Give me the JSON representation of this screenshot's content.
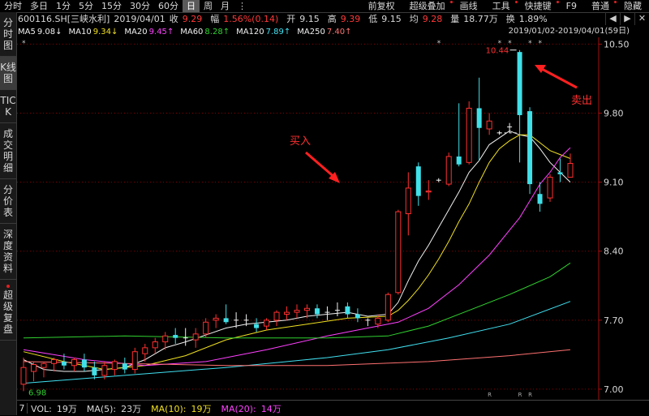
{
  "toolbar": {
    "items": [
      {
        "label": "分时",
        "selected": false
      },
      {
        "label": "多日",
        "selected": false
      },
      {
        "label": "1分",
        "selected": false
      },
      {
        "label": "5分",
        "selected": false
      },
      {
        "label": "15分",
        "selected": false
      },
      {
        "label": "30分",
        "selected": false
      },
      {
        "label": "60分",
        "selected": false
      },
      {
        "label": "日",
        "selected": true
      },
      {
        "label": "周",
        "selected": false
      },
      {
        "label": "月",
        "selected": false
      }
    ],
    "more_icon": "dots-vertical-icon",
    "right_items": [
      {
        "label": "前复权",
        "dot": false
      },
      {
        "label": "超级叠加",
        "dot": true
      },
      {
        "label": "画线",
        "dot": false
      },
      {
        "label": "工具",
        "dot": true
      },
      {
        "label": "快捷键",
        "dot": true
      },
      {
        "label": "F9",
        "dot": false
      },
      {
        "label": "普通",
        "dot": true
      },
      {
        "label": "隐藏",
        "dot": false
      }
    ]
  },
  "quote": {
    "code": "600116.SH[三峡水利]",
    "date": "2019/04/01",
    "close_label": "收",
    "close": "9.29",
    "change_label": "幅",
    "change": "1.56%(0.14)",
    "open_label": "开",
    "open": "9.15",
    "high_label": "高",
    "high": "9.39",
    "low_label": "低",
    "low": "9.15",
    "avg_label": "均",
    "avg": "9.28",
    "vol_label": "量",
    "vol": "18.77万",
    "turn_label": "换",
    "turn": "1.89%"
  },
  "window_buttons": {
    "prev": "◀",
    "next": "▶",
    "close": "✕"
  },
  "ma_line": [
    {
      "label": "MA5",
      "value": "9.08↓",
      "color": "#f0f0f0",
      "value_color": "#f0f0f0"
    },
    {
      "label": "MA10",
      "value": "9.34↓",
      "color": "#f0f0f0",
      "value_color": "#f0e020"
    },
    {
      "label": "MA20",
      "value": "9.45↑",
      "color": "#f0f0f0",
      "value_color": "#ff40ff"
    },
    {
      "label": "MA60",
      "value": "8.28↑",
      "color": "#f0f0f0",
      "value_color": "#30d030"
    },
    {
      "label": "MA120",
      "value": "7.89↑",
      "color": "#f0f0f0",
      "value_color": "#40e0f0"
    },
    {
      "label": "MA250",
      "value": "7.40↑",
      "color": "#f0f0f0",
      "value_color": "#ff7070"
    }
  ],
  "date_range": "2019/01/02-2019/04/01(59日)",
  "left_tabs": [
    {
      "label": "分时图",
      "selected": false,
      "dot": false
    },
    {
      "label": "K线图",
      "selected": true,
      "dot": false
    },
    {
      "label": "TICK",
      "selected": false,
      "dot": false
    },
    {
      "label": "成交明细",
      "selected": false,
      "dot": false
    },
    {
      "label": "分价表",
      "selected": false,
      "dot": false
    },
    {
      "label": "深度资料",
      "selected": false,
      "dot": false
    },
    {
      "label": "超级复盘",
      "selected": false,
      "dot": true
    }
  ],
  "annotations": {
    "buy": "买入",
    "sell": "卖出",
    "max_label": "10.44",
    "min_label": "6.98"
  },
  "bottom_bar": {
    "panel_num": "7",
    "vol_label": "VOL:",
    "vol": "19万",
    "ma5_label": "MA(5):",
    "ma5": "23万",
    "ma10_label": "MA(10):",
    "ma10": "19万",
    "ma20_label": "MA(20):",
    "ma20": "14万"
  },
  "colors": {
    "up": "#ff3030",
    "down": "#40e0e8",
    "flat": "#f0f0f0",
    "ma5": "#f0f0f0",
    "ma10": "#f0e020",
    "ma20": "#ff40ff",
    "ma60": "#30d030",
    "ma120": "#40e0f0",
    "ma250": "#ff7070",
    "grid": "#8b0000",
    "axis_text": "#d8d8d8"
  },
  "chart_data": {
    "type": "candlestick",
    "y_ticks": [
      7.0,
      7.7,
      8.4,
      9.1,
      9.8,
      10.5
    ],
    "ylim": [
      6.95,
      10.52
    ],
    "candles": [
      {
        "o": 7.05,
        "h": 7.32,
        "l": 6.98,
        "c": 7.22
      },
      {
        "o": 7.18,
        "h": 7.28,
        "l": 7.08,
        "c": 7.25
      },
      {
        "o": 7.22,
        "h": 7.28,
        "l": 7.12,
        "c": 7.26
      },
      {
        "o": 7.26,
        "h": 7.32,
        "l": 7.18,
        "c": 7.3
      },
      {
        "o": 7.28,
        "h": 7.36,
        "l": 7.2,
        "c": 7.24
      },
      {
        "o": 7.24,
        "h": 7.32,
        "l": 7.18,
        "c": 7.3
      },
      {
        "o": 7.3,
        "h": 7.36,
        "l": 7.18,
        "c": 7.22
      },
      {
        "o": 7.22,
        "h": 7.28,
        "l": 7.1,
        "c": 7.14
      },
      {
        "o": 7.14,
        "h": 7.28,
        "l": 7.1,
        "c": 7.24
      },
      {
        "o": 7.2,
        "h": 7.3,
        "l": 7.14,
        "c": 7.28
      },
      {
        "o": 7.26,
        "h": 7.32,
        "l": 7.16,
        "c": 7.2
      },
      {
        "o": 7.2,
        "h": 7.42,
        "l": 7.16,
        "c": 7.38
      },
      {
        "o": 7.36,
        "h": 7.46,
        "l": 7.28,
        "c": 7.42
      },
      {
        "o": 7.42,
        "h": 7.52,
        "l": 7.36,
        "c": 7.48
      },
      {
        "o": 7.48,
        "h": 7.58,
        "l": 7.4,
        "c": 7.54
      },
      {
        "o": 7.55,
        "h": 7.62,
        "l": 7.46,
        "c": 7.52
      },
      {
        "o": 7.52,
        "h": 7.62,
        "l": 7.44,
        "c": 7.52
      },
      {
        "o": 7.5,
        "h": 7.62,
        "l": 7.42,
        "c": 7.56
      },
      {
        "o": 7.56,
        "h": 7.72,
        "l": 7.52,
        "c": 7.68
      },
      {
        "o": 7.7,
        "h": 7.76,
        "l": 7.62,
        "c": 7.72
      },
      {
        "o": 7.72,
        "h": 7.86,
        "l": 7.66,
        "c": 7.68
      },
      {
        "o": 7.7,
        "h": 7.78,
        "l": 7.62,
        "c": 7.7
      },
      {
        "o": 7.7,
        "h": 7.76,
        "l": 7.64,
        "c": 7.7
      },
      {
        "o": 7.66,
        "h": 7.72,
        "l": 7.58,
        "c": 7.62
      },
      {
        "o": 7.64,
        "h": 7.72,
        "l": 7.6,
        "c": 7.7
      },
      {
        "o": 7.7,
        "h": 7.8,
        "l": 7.64,
        "c": 7.78
      },
      {
        "o": 7.76,
        "h": 7.84,
        "l": 7.7,
        "c": 7.78
      },
      {
        "o": 7.78,
        "h": 7.86,
        "l": 7.72,
        "c": 7.8
      },
      {
        "o": 7.8,
        "h": 7.86,
        "l": 7.72,
        "c": 7.82
      },
      {
        "o": 7.82,
        "h": 7.86,
        "l": 7.72,
        "c": 7.76
      },
      {
        "o": 7.78,
        "h": 7.84,
        "l": 7.7,
        "c": 7.78
      },
      {
        "o": 7.8,
        "h": 7.88,
        "l": 7.74,
        "c": 7.8
      },
      {
        "o": 7.84,
        "h": 7.88,
        "l": 7.72,
        "c": 7.76
      },
      {
        "o": 7.76,
        "h": 7.82,
        "l": 7.68,
        "c": 7.72
      },
      {
        "o": 7.7,
        "h": 7.72,
        "l": 7.64,
        "c": 7.7
      },
      {
        "o": 7.66,
        "h": 7.76,
        "l": 7.62,
        "c": 7.72
      },
      {
        "o": 7.7,
        "h": 7.98,
        "l": 7.68,
        "c": 7.96
      },
      {
        "o": 7.98,
        "h": 8.82,
        "l": 7.96,
        "c": 8.8
      },
      {
        "o": 8.78,
        "h": 9.2,
        "l": 8.56,
        "c": 9.04
      },
      {
        "o": 9.26,
        "h": 9.3,
        "l": 8.86,
        "c": 8.96
      },
      {
        "o": 9.0,
        "h": 9.12,
        "l": 8.92,
        "c": 9.01
      },
      {
        "o": 9.12,
        "h": 9.14,
        "l": 9.1,
        "c": 9.12
      },
      {
        "o": 9.08,
        "h": 9.4,
        "l": 9.06,
        "c": 9.36
      },
      {
        "o": 9.36,
        "h": 9.9,
        "l": 9.26,
        "c": 9.28
      },
      {
        "o": 9.3,
        "h": 9.92,
        "l": 9.28,
        "c": 9.85
      },
      {
        "o": 9.85,
        "h": 10.16,
        "l": 9.32,
        "c": 9.65
      },
      {
        "o": 9.64,
        "h": 9.8,
        "l": 9.58,
        "c": 9.72
      },
      {
        "o": 9.6,
        "h": 9.62,
        "l": 9.58,
        "c": 9.6
      },
      {
        "o": 9.66,
        "h": 9.7,
        "l": 9.6,
        "c": 9.66
      },
      {
        "o": 10.42,
        "h": 10.44,
        "l": 9.3,
        "c": 9.78
      },
      {
        "o": 9.82,
        "h": 9.86,
        "l": 8.98,
        "c": 9.08
      },
      {
        "o": 8.98,
        "h": 9.1,
        "l": 8.8,
        "c": 8.88
      },
      {
        "o": 8.94,
        "h": 9.18,
        "l": 8.9,
        "c": 9.15
      },
      {
        "o": 9.2,
        "h": 9.34,
        "l": 9.1,
        "c": 9.18
      },
      {
        "o": 9.15,
        "h": 9.39,
        "l": 9.15,
        "c": 9.29
      }
    ],
    "ma_series": [
      {
        "key": "ma5",
        "points": [
          [
            0,
            7.3
          ],
          [
            2,
            7.2
          ],
          [
            4,
            7.18
          ],
          [
            6,
            7.18
          ],
          [
            8,
            7.2
          ],
          [
            10,
            7.22
          ],
          [
            12,
            7.3
          ],
          [
            14,
            7.42
          ],
          [
            16,
            7.48
          ],
          [
            18,
            7.55
          ],
          [
            20,
            7.62
          ],
          [
            22,
            7.66
          ],
          [
            24,
            7.68
          ],
          [
            26,
            7.7
          ],
          [
            28,
            7.74
          ],
          [
            30,
            7.76
          ],
          [
            32,
            7.78
          ],
          [
            34,
            7.74
          ],
          [
            36,
            7.76
          ],
          [
            37,
            7.88
          ],
          [
            38,
            8.1
          ],
          [
            39,
            8.3
          ],
          [
            40,
            8.46
          ],
          [
            41,
            8.64
          ],
          [
            42,
            8.82
          ],
          [
            43,
            9.0
          ],
          [
            44,
            9.2
          ],
          [
            45,
            9.32
          ],
          [
            46,
            9.48
          ],
          [
            47,
            9.55
          ],
          [
            48,
            9.62
          ],
          [
            49,
            9.58
          ],
          [
            50,
            9.56
          ],
          [
            51,
            9.44
          ],
          [
            52,
            9.3
          ],
          [
            53,
            9.2
          ],
          [
            54,
            9.1
          ]
        ]
      },
      {
        "key": "ma10",
        "points": [
          [
            0,
            7.38
          ],
          [
            4,
            7.28
          ],
          [
            8,
            7.2
          ],
          [
            12,
            7.24
          ],
          [
            16,
            7.34
          ],
          [
            20,
            7.5
          ],
          [
            24,
            7.6
          ],
          [
            28,
            7.66
          ],
          [
            32,
            7.72
          ],
          [
            36,
            7.74
          ],
          [
            37,
            7.8
          ],
          [
            38,
            7.9
          ],
          [
            39,
            8.02
          ],
          [
            40,
            8.16
          ],
          [
            41,
            8.32
          ],
          [
            42,
            8.5
          ],
          [
            43,
            8.7
          ],
          [
            44,
            8.88
          ],
          [
            45,
            9.1
          ],
          [
            46,
            9.3
          ],
          [
            47,
            9.44
          ],
          [
            48,
            9.52
          ],
          [
            49,
            9.58
          ],
          [
            50,
            9.58
          ],
          [
            51,
            9.5
          ],
          [
            52,
            9.42
          ],
          [
            53,
            9.38
          ],
          [
            54,
            9.34
          ]
        ]
      },
      {
        "key": "ma20",
        "points": [
          [
            0,
            7.4
          ],
          [
            6,
            7.3
          ],
          [
            12,
            7.24
          ],
          [
            18,
            7.28
          ],
          [
            24,
            7.4
          ],
          [
            30,
            7.54
          ],
          [
            34,
            7.62
          ],
          [
            37,
            7.68
          ],
          [
            40,
            7.82
          ],
          [
            43,
            8.06
          ],
          [
            46,
            8.36
          ],
          [
            49,
            8.74
          ],
          [
            51,
            9.08
          ],
          [
            52,
            9.2
          ],
          [
            53,
            9.35
          ],
          [
            54,
            9.45
          ]
        ]
      },
      {
        "key": "ma60",
        "points": [
          [
            0,
            7.52
          ],
          [
            10,
            7.54
          ],
          [
            20,
            7.52
          ],
          [
            30,
            7.52
          ],
          [
            36,
            7.54
          ],
          [
            40,
            7.64
          ],
          [
            44,
            7.8
          ],
          [
            48,
            7.96
          ],
          [
            52,
            8.14
          ],
          [
            54,
            8.28
          ]
        ]
      },
      {
        "key": "ma120",
        "points": [
          [
            0,
            7.06
          ],
          [
            10,
            7.14
          ],
          [
            20,
            7.22
          ],
          [
            30,
            7.32
          ],
          [
            36,
            7.4
          ],
          [
            42,
            7.52
          ],
          [
            48,
            7.66
          ],
          [
            54,
            7.89
          ]
        ]
      },
      {
        "key": "ma250",
        "points": [
          [
            0,
            7.28
          ],
          [
            10,
            7.26
          ],
          [
            20,
            7.24
          ],
          [
            30,
            7.24
          ],
          [
            40,
            7.28
          ],
          [
            48,
            7.34
          ],
          [
            54,
            7.4
          ]
        ]
      }
    ]
  }
}
